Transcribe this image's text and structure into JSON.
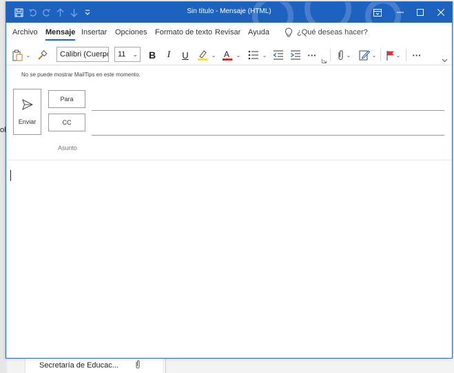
{
  "window": {
    "title": "Sin título  -  Mensaje (HTML)",
    "accent": "#1e62c0",
    "quick_access": [
      "save-icon",
      "undo-icon",
      "redo-icon",
      "arrow-up-icon",
      "arrow-down-icon",
      "customize-icon"
    ],
    "controls": [
      "ribbon-display-icon",
      "minimize-icon",
      "maximize-icon",
      "close-icon"
    ]
  },
  "tabs": [
    {
      "label": "Archivo"
    },
    {
      "label": "Mensaje",
      "active": true
    },
    {
      "label": "Insertar"
    },
    {
      "label": "Opciones"
    },
    {
      "label": "Formato de texto"
    },
    {
      "label": "Revisar"
    },
    {
      "label": "Ayuda"
    }
  ],
  "tell_me": {
    "label": "¿Qué deseas hacer?"
  },
  "ribbon": {
    "font_name": "Calibri (Cuerpo",
    "font_size": "11",
    "bold": "B",
    "italic": "I",
    "underline": "U",
    "font_color_letter": "A",
    "more": "···",
    "highlight_color": "#f7e41a",
    "font_color": "#e02020",
    "flag_color": "#d4373e"
  },
  "compose": {
    "mailtips": "No se puede mostrar MailTips en este momento.",
    "send_label": "Enviar",
    "to_label": "Para",
    "cc_label": "CC",
    "subject_label": "Asunto",
    "to_value": "",
    "cc_value": "",
    "subject_value": ""
  },
  "background": {
    "left_fragment": "ob",
    "list_item": "Secretaría de Educac..."
  }
}
